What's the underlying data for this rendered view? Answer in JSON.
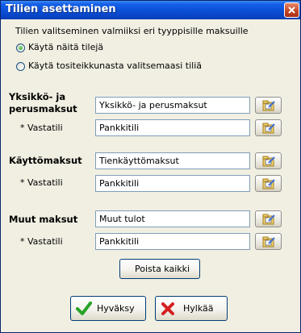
{
  "window": {
    "title": "Tilien asettaminen"
  },
  "intro": "Tilien valitseminen valmiiksi eri tyyppisille maksuille",
  "radios": [
    {
      "label": "Käytä näitä tilejä",
      "selected": true
    },
    {
      "label": "Käytä tositeikkunasta valitsemaasi tiliä",
      "selected": false
    }
  ],
  "groups": [
    {
      "label_line1": "Yksikkö- ja",
      "label_line2": "perusmaksut",
      "account": "Yksikkö- ja perusmaksut",
      "counter_label": "* Vastatili",
      "counter_account": "Pankkitili"
    },
    {
      "label": "Käyttömaksut",
      "account": "Tienkäyttömaksut",
      "counter_label": "* Vastatili",
      "counter_account": "Pankkitili"
    },
    {
      "label": "Muut maksut",
      "account": "Muut tulot",
      "counter_label": "* Vastatili",
      "counter_account": "Pankkitili"
    }
  ],
  "buttons": {
    "clear_all": "Poista kaikki",
    "accept": "Hyväksy",
    "reject": "Hylkää"
  },
  "icons": {
    "browse": "folder-edit-icon",
    "accept": "green-checkmark-icon",
    "reject": "red-x-icon",
    "close": "close-icon"
  },
  "colors": {
    "titlebar": "#0a4fd6",
    "dialog_bg": "#f1efe2",
    "field_border": "#7f9db9",
    "accept_green": "#27a327",
    "reject_red": "#d42020"
  }
}
